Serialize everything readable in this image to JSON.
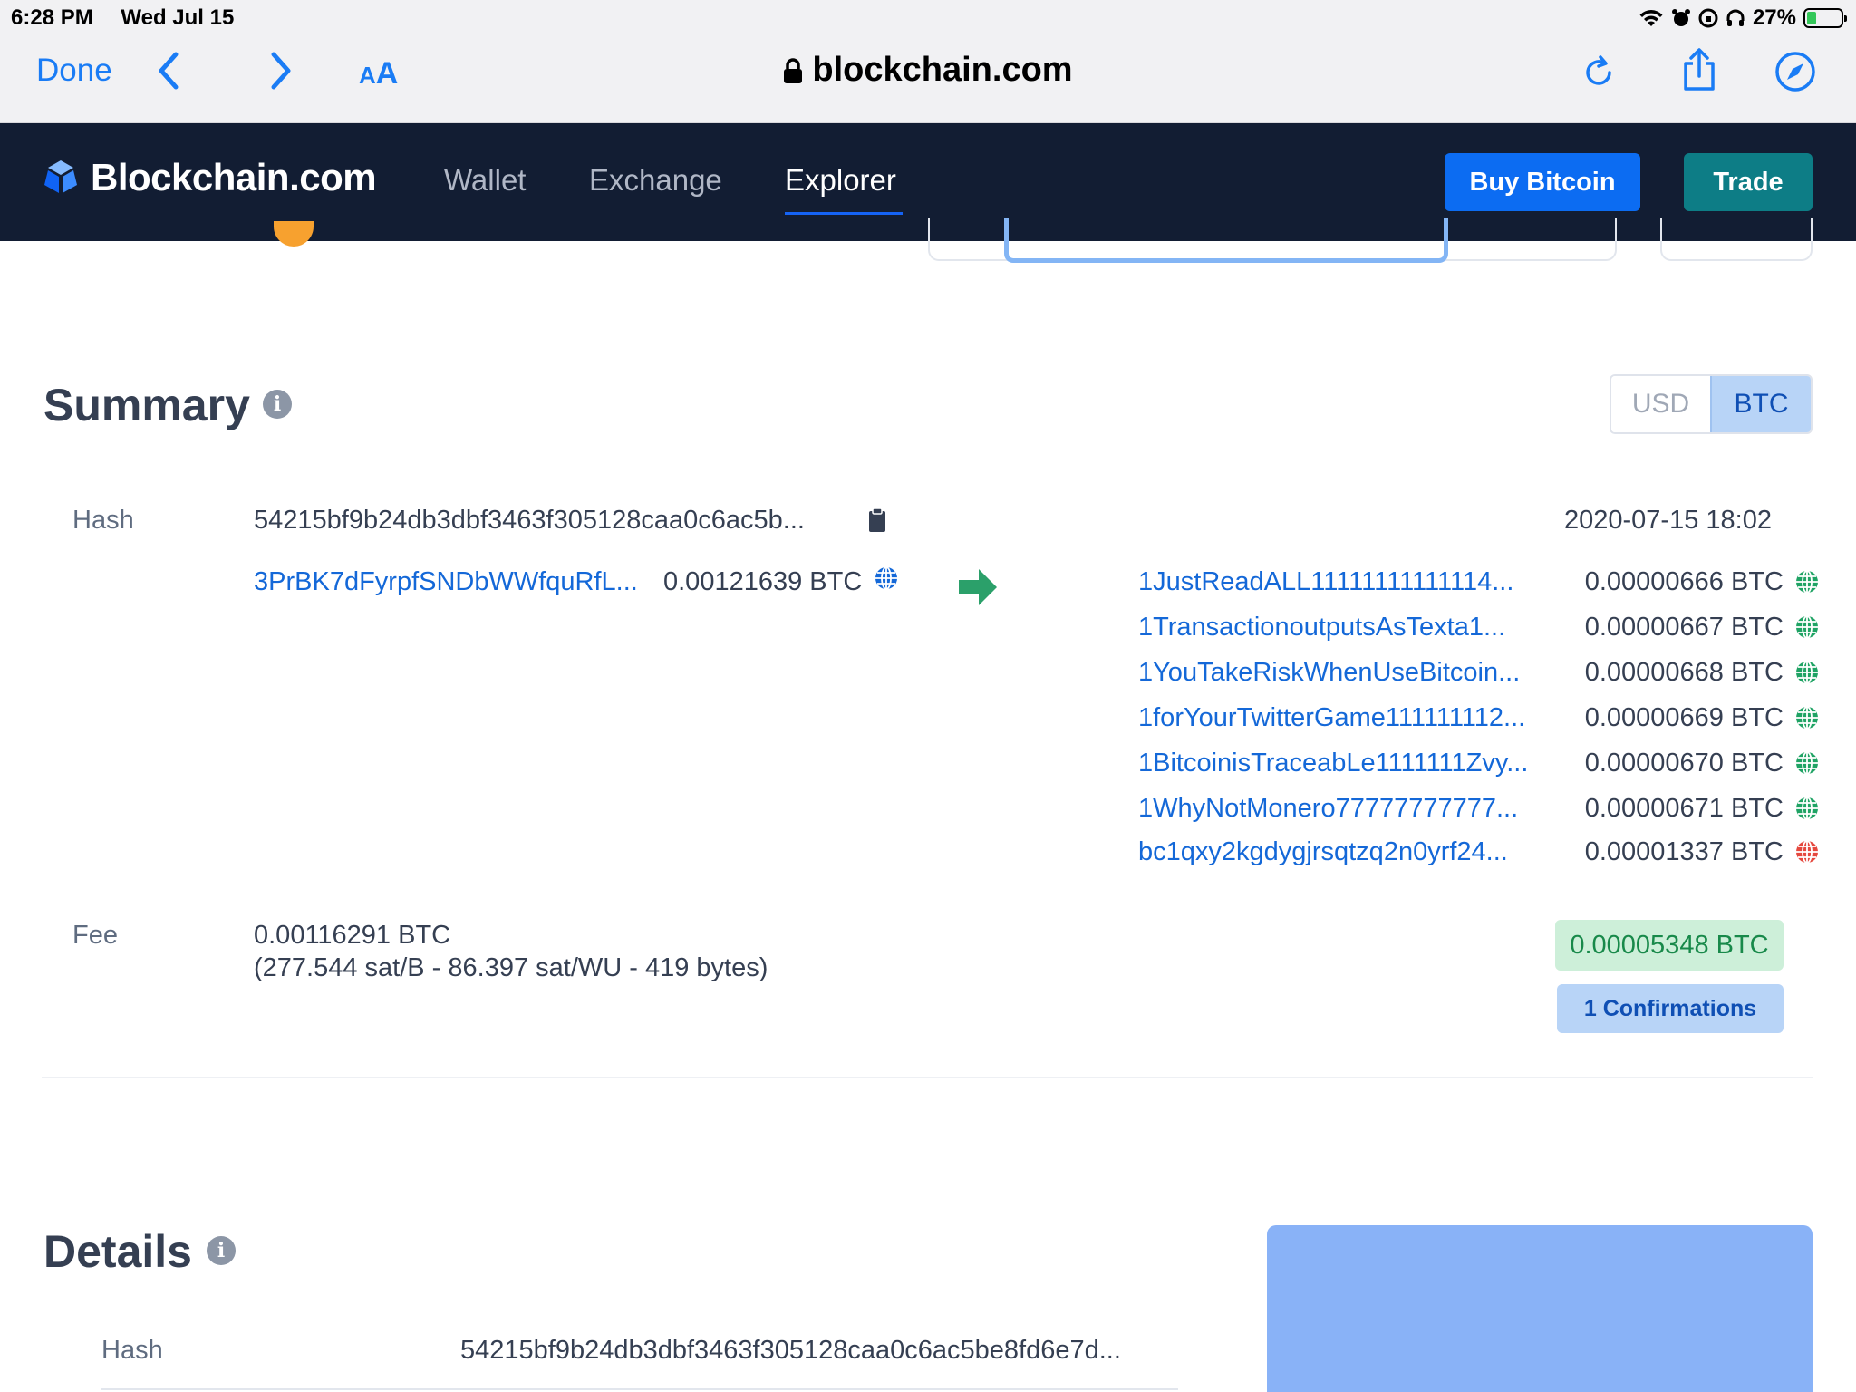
{
  "status_bar": {
    "time": "6:28 PM",
    "date": "Wed Jul 15",
    "battery": "27%"
  },
  "browser": {
    "done_label": "Done",
    "text_size_label_small": "A",
    "text_size_label_big": "A",
    "url": "blockchain.com"
  },
  "site": {
    "logo_text": "Blockchain.com",
    "nav": [
      "Wallet",
      "Exchange",
      "Explorer"
    ],
    "buy_label": "Buy Bitcoin",
    "trade_label": "Trade"
  },
  "summary": {
    "title": "Summary",
    "currency_options": [
      "USD",
      "BTC"
    ],
    "selected_currency": "BTC",
    "hash_label": "Hash",
    "hash": "54215bf9b24db3dbf3463f305128caa0c6ac5b...",
    "timestamp": "2020-07-15 18:02",
    "input": {
      "address": "3PrBK7dFyrpfSNDbWWfquRfL...",
      "amount": "0.00121639 BTC"
    },
    "outputs": [
      {
        "address": "1JustReadALL11111111111114...",
        "amount": "0.00000666 BTC",
        "status": "unspent"
      },
      {
        "address": "1TransactionoutputsAsTexta1...",
        "amount": "0.00000667 BTC",
        "status": "unspent"
      },
      {
        "address": "1YouTakeRiskWhenUseBitcoin...",
        "amount": "0.00000668 BTC",
        "status": "unspent"
      },
      {
        "address": "1forYourTwitterGame111111112...",
        "amount": "0.00000669 BTC",
        "status": "unspent"
      },
      {
        "address": "1BitcoinisTraceabLe1111111Zvy...",
        "amount": "0.00000670 BTC",
        "status": "unspent"
      },
      {
        "address": "1WhyNotMonero77777777777...",
        "amount": "0.00000671 BTC",
        "status": "unspent"
      },
      {
        "address": "bc1qxy2kgdygjrsqtzq2n0yrf24...",
        "amount": "0.00001337 BTC",
        "status": "spent"
      }
    ],
    "fee_label": "Fee",
    "fee_value": "0.00116291 BTC",
    "fee_detail": "(277.544 sat/B - 86.397 sat/WU - 419 bytes)",
    "total_output": "0.00005348 BTC",
    "confirmations": "1 Confirmations"
  },
  "details": {
    "title": "Details",
    "hash_label": "Hash",
    "hash": "54215bf9b24db3dbf3463f305128caa0c6ac5be8fd6e7d..."
  },
  "colors": {
    "header_bg": "#121d33",
    "link": "#1468d8",
    "buy_button": "#0c6cf2",
    "trade_button": "#0d7d86",
    "unspent_globe": "#1fa364",
    "spent_globe": "#e5483e",
    "input_globe": "#1468d8",
    "arrow": "#2ba06a"
  },
  "icons": {
    "lock": "lock-icon",
    "reload": "reload-icon",
    "share": "share-icon",
    "compass": "compass-icon",
    "clipboard": "clipboard-icon",
    "globe": "globe-icon",
    "arrow": "arrow-right-icon",
    "info": "info-icon"
  }
}
